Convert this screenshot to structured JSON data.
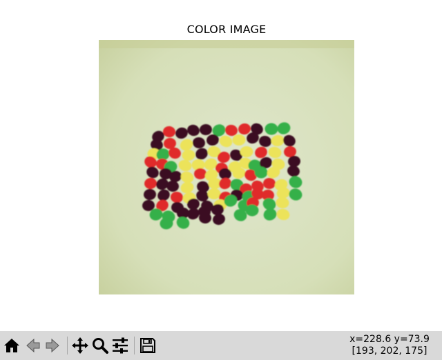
{
  "figure": {
    "title": "COLOR IMAGE"
  },
  "image": {
    "subject": "jelly beans",
    "background_color": "#dbe3c2",
    "bean_colors": {
      "dark": "#3a1022",
      "red": "#e02b2b",
      "yellow": "#ece35a",
      "green": "#34b04a"
    }
  },
  "toolbar": {
    "buttons": [
      {
        "name": "home-button",
        "icon": "home-icon"
      },
      {
        "name": "back-button",
        "icon": "arrow-left-icon"
      },
      {
        "name": "forward-button",
        "icon": "arrow-right-icon"
      },
      {
        "name": "pan-button",
        "icon": "move-icon"
      },
      {
        "name": "zoom-button",
        "icon": "magnifier-icon"
      },
      {
        "name": "configure-subplots-button",
        "icon": "sliders-icon"
      },
      {
        "name": "save-button",
        "icon": "floppy-disk-icon"
      }
    ]
  },
  "status": {
    "coords": "x=228.6 y=73.9",
    "pixel_value": "[193, 202, 175]"
  }
}
